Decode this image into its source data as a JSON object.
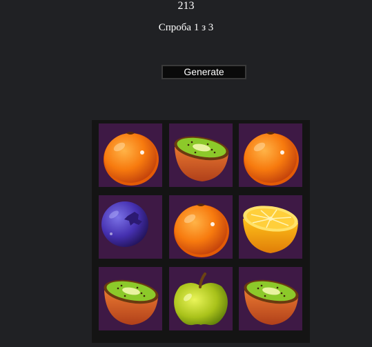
{
  "game": {
    "score": "213",
    "attempts_text": "Спроба 1 з 3",
    "generate_label": "Generate"
  },
  "board": {
    "cells": [
      {
        "fruit": "orange"
      },
      {
        "fruit": "kiwi-half"
      },
      {
        "fruit": "orange"
      },
      {
        "fruit": "blueberry"
      },
      {
        "fruit": "orange"
      },
      {
        "fruit": "lemon-half"
      },
      {
        "fruit": "kiwi-half"
      },
      {
        "fruit": "green-apple"
      },
      {
        "fruit": "kiwi-half"
      }
    ]
  },
  "colors": {
    "page_bg": "#202124",
    "board_bg": "#141414",
    "cell_bg": "#3e1945"
  }
}
